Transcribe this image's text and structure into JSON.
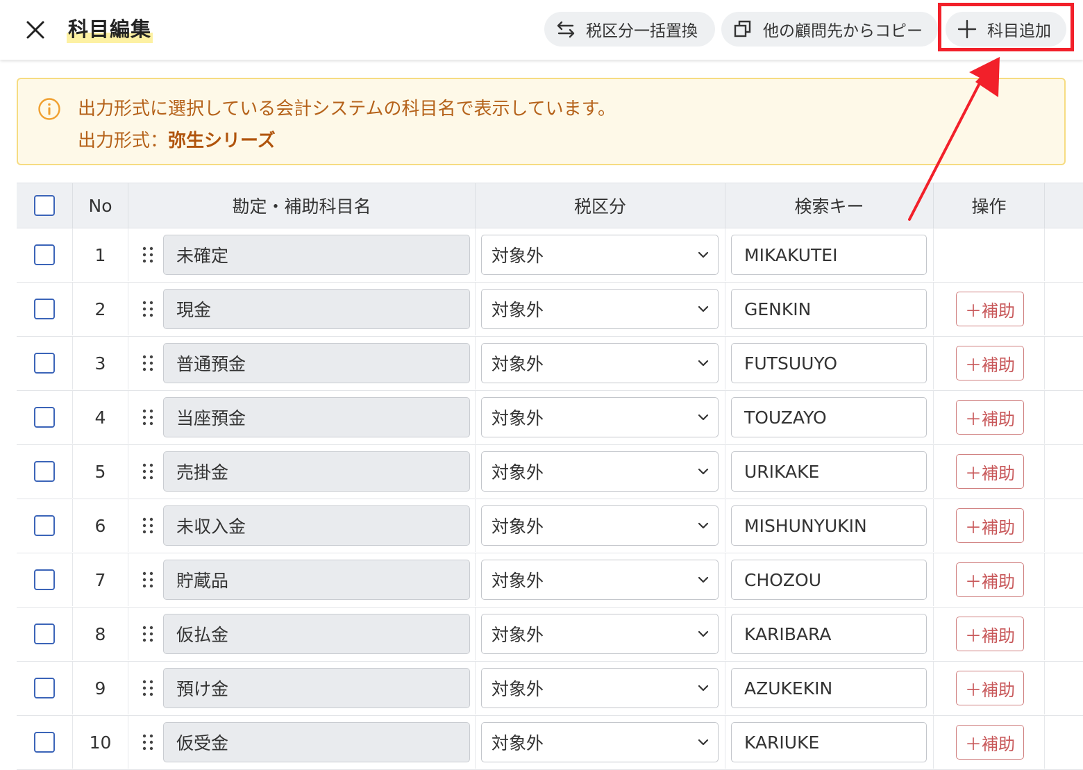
{
  "header": {
    "title": "科目編集",
    "tax_bulk_label": "税区分一括置換",
    "copy_label": "他の顧問先からコピー",
    "add_label": "科目追加"
  },
  "notice": {
    "line1": "出力形式に選択している会計システムの科目名で表示しています。",
    "line2_prefix": "出力形式：",
    "line2_value": "弥生シリーズ"
  },
  "table": {
    "headers": {
      "no": "No",
      "name": "勘定・補助科目名",
      "tax": "税区分",
      "key": "検索キー",
      "op": "操作"
    },
    "sub_button_label": "＋補助",
    "rows": [
      {
        "no": "1",
        "name": "未確定",
        "tax": "対象外",
        "key": "MIKAKUTEI",
        "has_sub": false
      },
      {
        "no": "2",
        "name": "現金",
        "tax": "対象外",
        "key": "GENKIN",
        "has_sub": true
      },
      {
        "no": "3",
        "name": "普通預金",
        "tax": "対象外",
        "key": "FUTSUUYO",
        "has_sub": true
      },
      {
        "no": "4",
        "name": "当座預金",
        "tax": "対象外",
        "key": "TOUZAYO",
        "has_sub": true
      },
      {
        "no": "5",
        "name": "売掛金",
        "tax": "対象外",
        "key": "URIKAKE",
        "has_sub": true
      },
      {
        "no": "6",
        "name": "未収入金",
        "tax": "対象外",
        "key": "MISHUNYUKIN",
        "has_sub": true
      },
      {
        "no": "7",
        "name": "貯蔵品",
        "tax": "対象外",
        "key": "CHOZOU",
        "has_sub": true
      },
      {
        "no": "8",
        "name": "仮払金",
        "tax": "対象外",
        "key": "KARIBARA",
        "has_sub": true
      },
      {
        "no": "9",
        "name": "預け金",
        "tax": "対象外",
        "key": "AZUKEKIN",
        "has_sub": true
      },
      {
        "no": "10",
        "name": "仮受金",
        "tax": "対象外",
        "key": "KARIUKE",
        "has_sub": true
      }
    ]
  },
  "colors": {
    "accent_red": "#f2202a",
    "checkbox_blue": "#3b64b8",
    "notice_text": "#b5621a",
    "sub_button_red": "#c8585a"
  }
}
